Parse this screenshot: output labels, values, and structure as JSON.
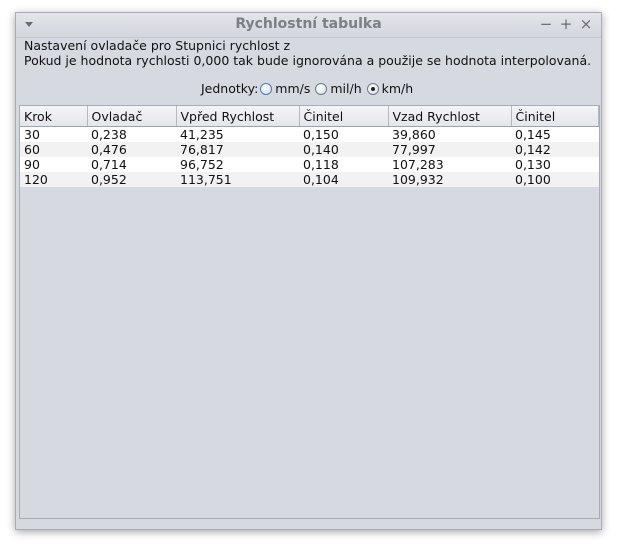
{
  "window": {
    "title": "Rychlostní tabulka",
    "buttons": {
      "minimize": "−",
      "maximize": "+",
      "close": "×"
    }
  },
  "info": {
    "line1": "Nastavení ovladače pro Stupnici rychlost z",
    "line2": "Pokud je hodnota rychlosti 0,000 tak bude ignorována a použije se hodnota interpolovaná."
  },
  "units": {
    "label": "Jednotky:",
    "options": [
      "mm/s",
      "mil/h",
      "km/h"
    ],
    "selected": "km/h"
  },
  "table": {
    "columns": [
      "Krok",
      "Ovladač",
      "Vpřed Rychlost",
      "Činitel",
      "Vzad Rychlost",
      "Činitel"
    ],
    "rows": [
      [
        "30",
        "0,238",
        "41,235",
        "0,150",
        "39,860",
        "0,145"
      ],
      [
        "60",
        "0,476",
        "76,817",
        "0,140",
        "77,997",
        "0,142"
      ],
      [
        "90",
        "0,714",
        "96,752",
        "0,118",
        "107,283",
        "0,130"
      ],
      [
        "120",
        "0,952",
        "113,751",
        "0,104",
        "109,932",
        "0,100"
      ]
    ]
  }
}
